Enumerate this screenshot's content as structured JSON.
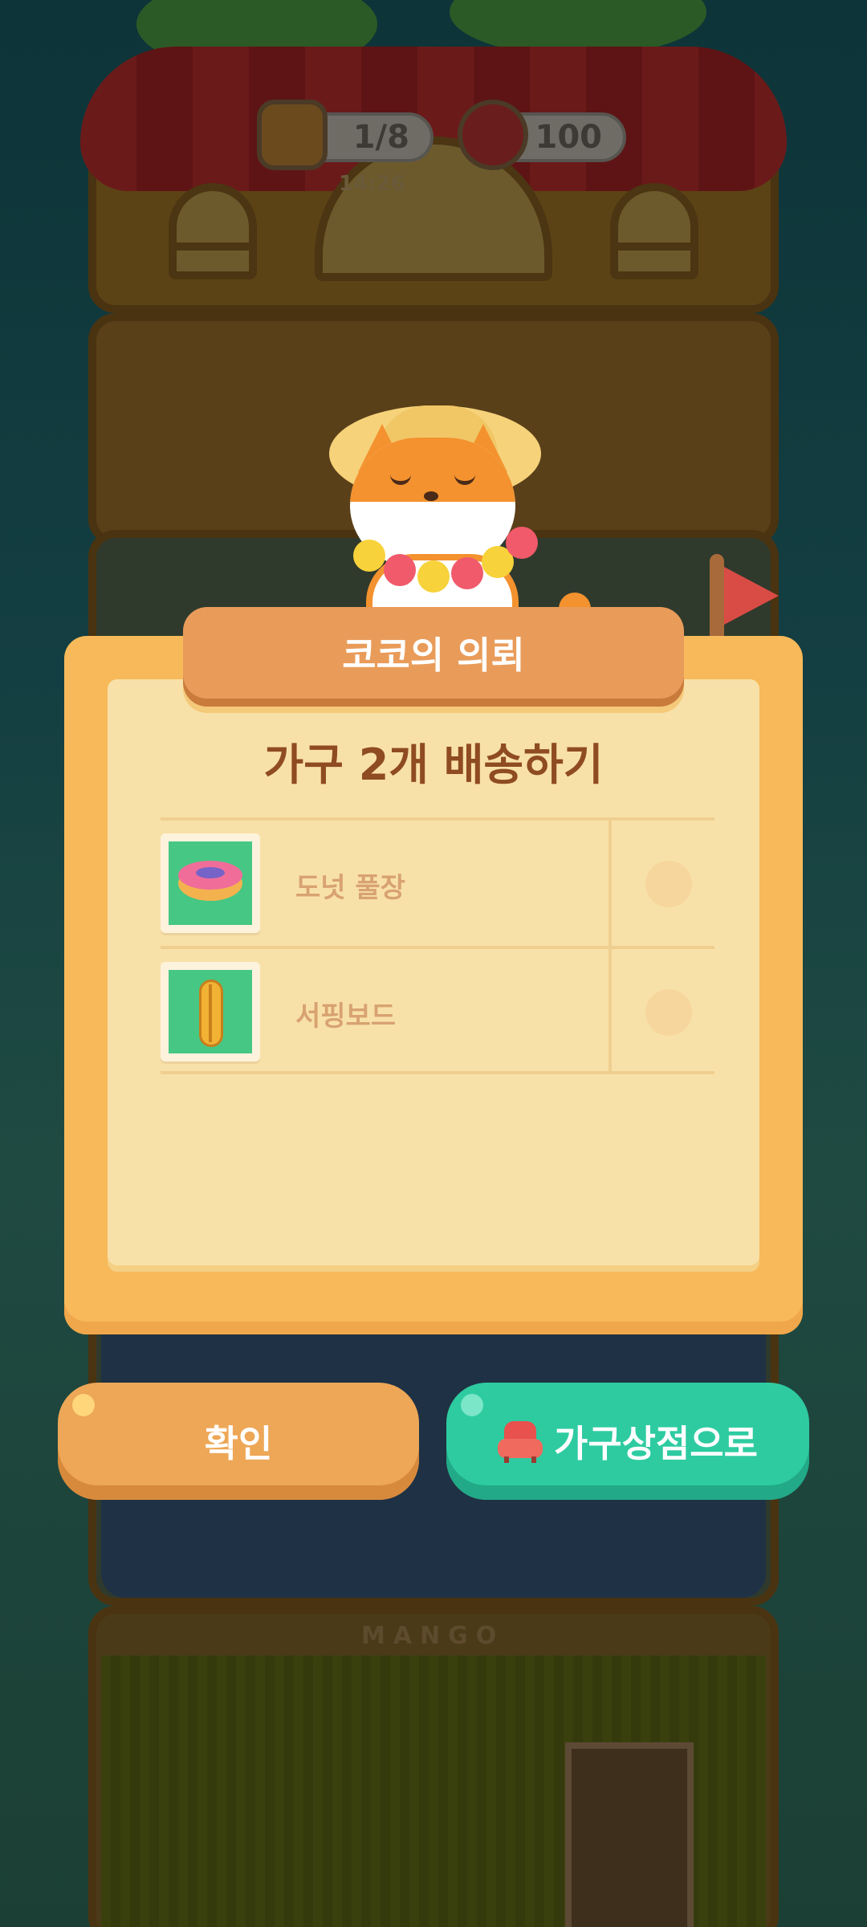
{
  "hud": {
    "jam_count": "1/8",
    "jam_timer": "14:26",
    "can_count": "100"
  },
  "background": {
    "sign_text": "MANGO"
  },
  "dialog": {
    "title": "코코의 의뢰",
    "quest": "가구 2개 배송하기",
    "items": [
      {
        "label": "도넛 풀장",
        "icon": "donut-pool-icon",
        "completed": false
      },
      {
        "label": "서핑보드",
        "icon": "surfboard-icon",
        "completed": false
      }
    ]
  },
  "buttons": {
    "confirm": "확인",
    "shop": "가구상점으로",
    "shop_icon": "sofa-icon"
  },
  "colors": {
    "panel": "#f7b95a",
    "banner": "#e99c5a",
    "card": "#f8e1a8",
    "quest_text": "#8f4b22",
    "confirm_button": "#eda757",
    "shop_button": "#2ecba1"
  }
}
